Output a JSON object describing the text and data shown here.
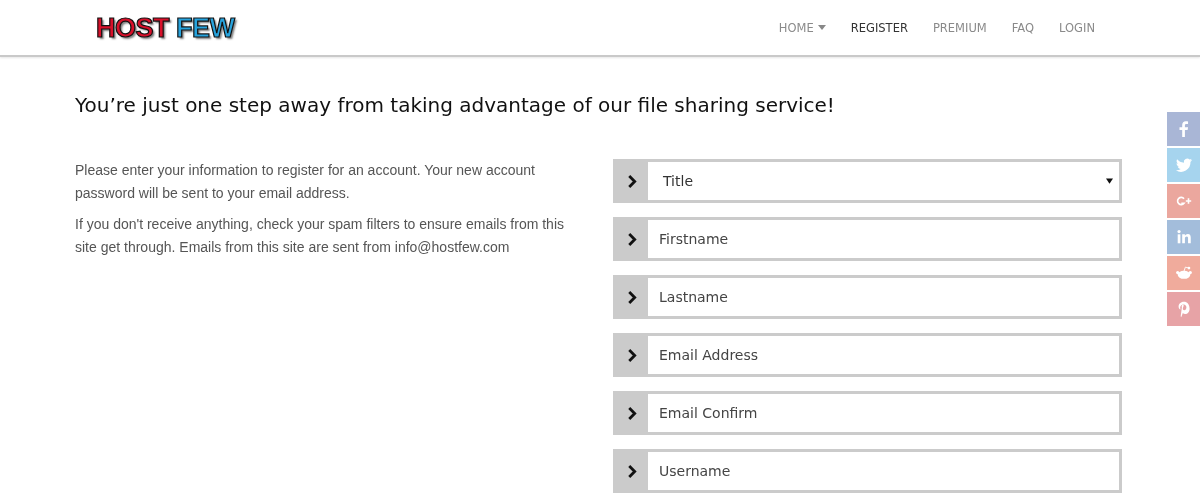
{
  "header": {
    "logo": [
      "HOST",
      "FEW"
    ],
    "nav": [
      {
        "label": "HOME",
        "selected": false,
        "has_menu": true
      },
      {
        "label": "REGISTER",
        "selected": true,
        "has_menu": false
      },
      {
        "label": "PREMIUM",
        "selected": false,
        "has_menu": false
      },
      {
        "label": "FAQ",
        "selected": false,
        "has_menu": false
      },
      {
        "label": "LOGIN",
        "selected": false,
        "has_menu": false
      }
    ]
  },
  "subtitle": "You’re just one step away from taking advantage of our file sharing service!",
  "intro": [
    "Please enter your information to register for an account. Your new account password will be sent to your email address.",
    "If you don't receive anything, check your spam filters to ensure emails from this site get through. Emails from this site are sent from info@hostfew.com"
  ],
  "form": [
    {
      "kind": "select",
      "value": "Title"
    },
    {
      "kind": "input",
      "placeholder": "Firstname"
    },
    {
      "kind": "input",
      "placeholder": "Lastname"
    },
    {
      "kind": "input",
      "placeholder": "Email Address"
    },
    {
      "kind": "input",
      "placeholder": "Email Confirm"
    },
    {
      "kind": "input",
      "placeholder": "Username"
    }
  ],
  "social": [
    {
      "kind": "facebook",
      "color": "#a9b6d6"
    },
    {
      "kind": "twitter",
      "color": "#a6d4ee"
    },
    {
      "kind": "google-plus",
      "color": "#eba79e"
    },
    {
      "kind": "linkedin",
      "color": "#a3bddb"
    },
    {
      "kind": "reddit",
      "color": "#f0ab9c"
    },
    {
      "kind": "pinterest",
      "color": "#e7a3a6"
    }
  ]
}
